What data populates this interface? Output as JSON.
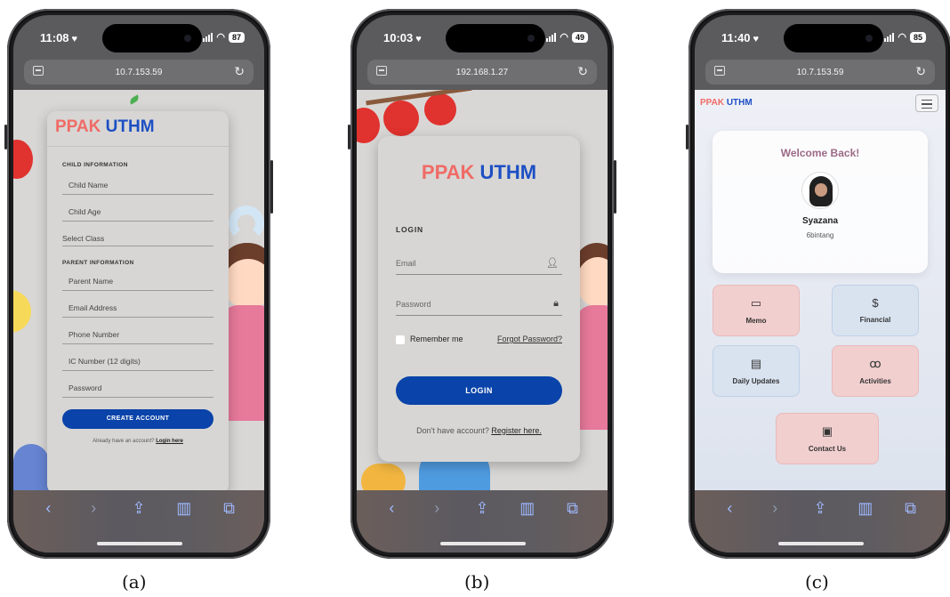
{
  "screens": {
    "a": {
      "time": "11:08",
      "battery": "87",
      "url": "10.7.153.59",
      "logo": {
        "ppak": "PPAK",
        "uthm": "UTHM"
      },
      "child_section": "CHILD INFORMATION",
      "child_fields": [
        "Child Name",
        "Child Age",
        "Select Class"
      ],
      "parent_section": "PARENT INFORMATION",
      "parent_fields": [
        "Parent Name",
        "Email Address",
        "Phone Number",
        "IC Number (12 digits)",
        "Password"
      ],
      "create_button": "CREATE ACCOUNT",
      "footer_text": "Already have an account?",
      "footer_link": "Login here",
      "caption": "(a)"
    },
    "b": {
      "time": "10:03",
      "battery": "49",
      "url": "192.168.1.27",
      "logo": {
        "ppak": "PPAK",
        "uthm": "UTHM"
      },
      "login_title": "LOGIN",
      "email_placeholder": "Email",
      "password_placeholder": "Password",
      "remember_label": "Remember me",
      "forgot_link": "Forgot Password?",
      "login_button": "LOGIN",
      "footer_text": "Don't have account?",
      "footer_link": "Register here.",
      "caption": "(b)"
    },
    "c": {
      "time": "11:40",
      "battery": "85",
      "url": "10.7.153.59",
      "logo": {
        "ppak": "PPAK",
        "uthm": "UTHM"
      },
      "welcome": "Welcome Back!",
      "user_name": "Syazana",
      "user_class": "6bintang",
      "tiles": [
        {
          "label": "Memo",
          "icon": "calendar-icon",
          "glyph": "▭"
        },
        {
          "label": "Financial",
          "icon": "dollar-icon",
          "glyph": "$"
        },
        {
          "label": "Daily Updates",
          "icon": "document-icon",
          "glyph": "▤"
        },
        {
          "label": "Activities",
          "icon": "people-icon",
          "glyph": "ꝏ"
        },
        {
          "label": "Contact Us",
          "icon": "contact-card-icon",
          "glyph": "▣"
        }
      ],
      "caption": "(c)"
    }
  },
  "colors": {
    "ppak": "#f06b66",
    "uthm": "#1d4fc4",
    "primary_button": "#0a43a9",
    "tile_pink": "#f2cfcf",
    "tile_blue": "#d9e3f0"
  }
}
